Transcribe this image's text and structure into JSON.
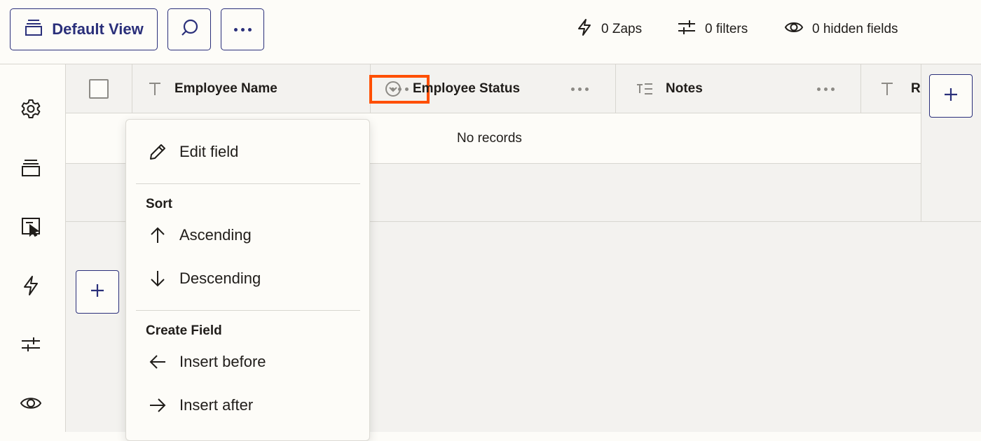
{
  "toolbar": {
    "default_view_label": "Default View",
    "zaps_label": "0 Zaps",
    "filters_label": "0 filters",
    "hidden_fields_label": "0 hidden fields"
  },
  "sidebar": {
    "items": [
      {
        "icon": "gear-icon"
      },
      {
        "icon": "stack-icon"
      },
      {
        "icon": "interface-icon"
      },
      {
        "icon": "lightning-icon"
      },
      {
        "icon": "filter-icon"
      },
      {
        "icon": "eye-icon"
      }
    ]
  },
  "columns": [
    {
      "label": "Employee Name",
      "icon": "text-type-icon"
    },
    {
      "label": "Employee Status",
      "icon": "dropdown-type-icon"
    },
    {
      "label": "Notes",
      "icon": "long-text-type-icon"
    },
    {
      "label": "R",
      "icon": "text-type-icon"
    }
  ],
  "table": {
    "empty_message": "No records"
  },
  "menu": {
    "edit_field": "Edit field",
    "sort_heading": "Sort",
    "ascending": "Ascending",
    "descending": "Descending",
    "create_heading": "Create Field",
    "insert_before": "Insert before",
    "insert_after": "Insert after"
  },
  "colors": {
    "accent": "#2a2f7a",
    "highlight": "#ff4f00",
    "background": "#fdfcf8",
    "grid": "#f3f2ef"
  }
}
